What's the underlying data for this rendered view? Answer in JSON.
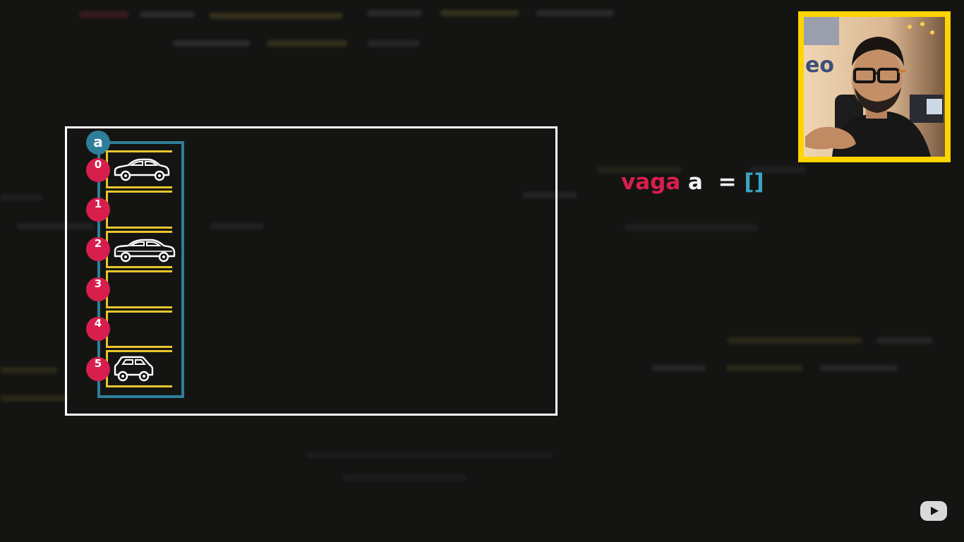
{
  "diagram": {
    "array_label": "a",
    "indices": [
      "0",
      "1",
      "2",
      "3",
      "4",
      "5"
    ],
    "slots": [
      {
        "index": "0",
        "vehicle": "sedan-car-icon"
      },
      {
        "index": "1",
        "vehicle": ""
      },
      {
        "index": "2",
        "vehicle": "hatchback-car-icon"
      },
      {
        "index": "3",
        "vehicle": ""
      },
      {
        "index": "4",
        "vehicle": ""
      },
      {
        "index": "5",
        "vehicle": "suv-car-icon"
      }
    ]
  },
  "code": {
    "keyword": "vaga",
    "variable": "a",
    "equals": "=",
    "brackets": "[]"
  },
  "colors": {
    "background": "#141513",
    "frame": "#ffffff",
    "array_border": "#2e7e9a",
    "slot_lines": "#e8c52c",
    "index_badge": "#d81e4c",
    "webcam_border": "#ffd400"
  },
  "icons": {
    "webcam": "presenter-webcam",
    "logo": "youtube-icon"
  }
}
